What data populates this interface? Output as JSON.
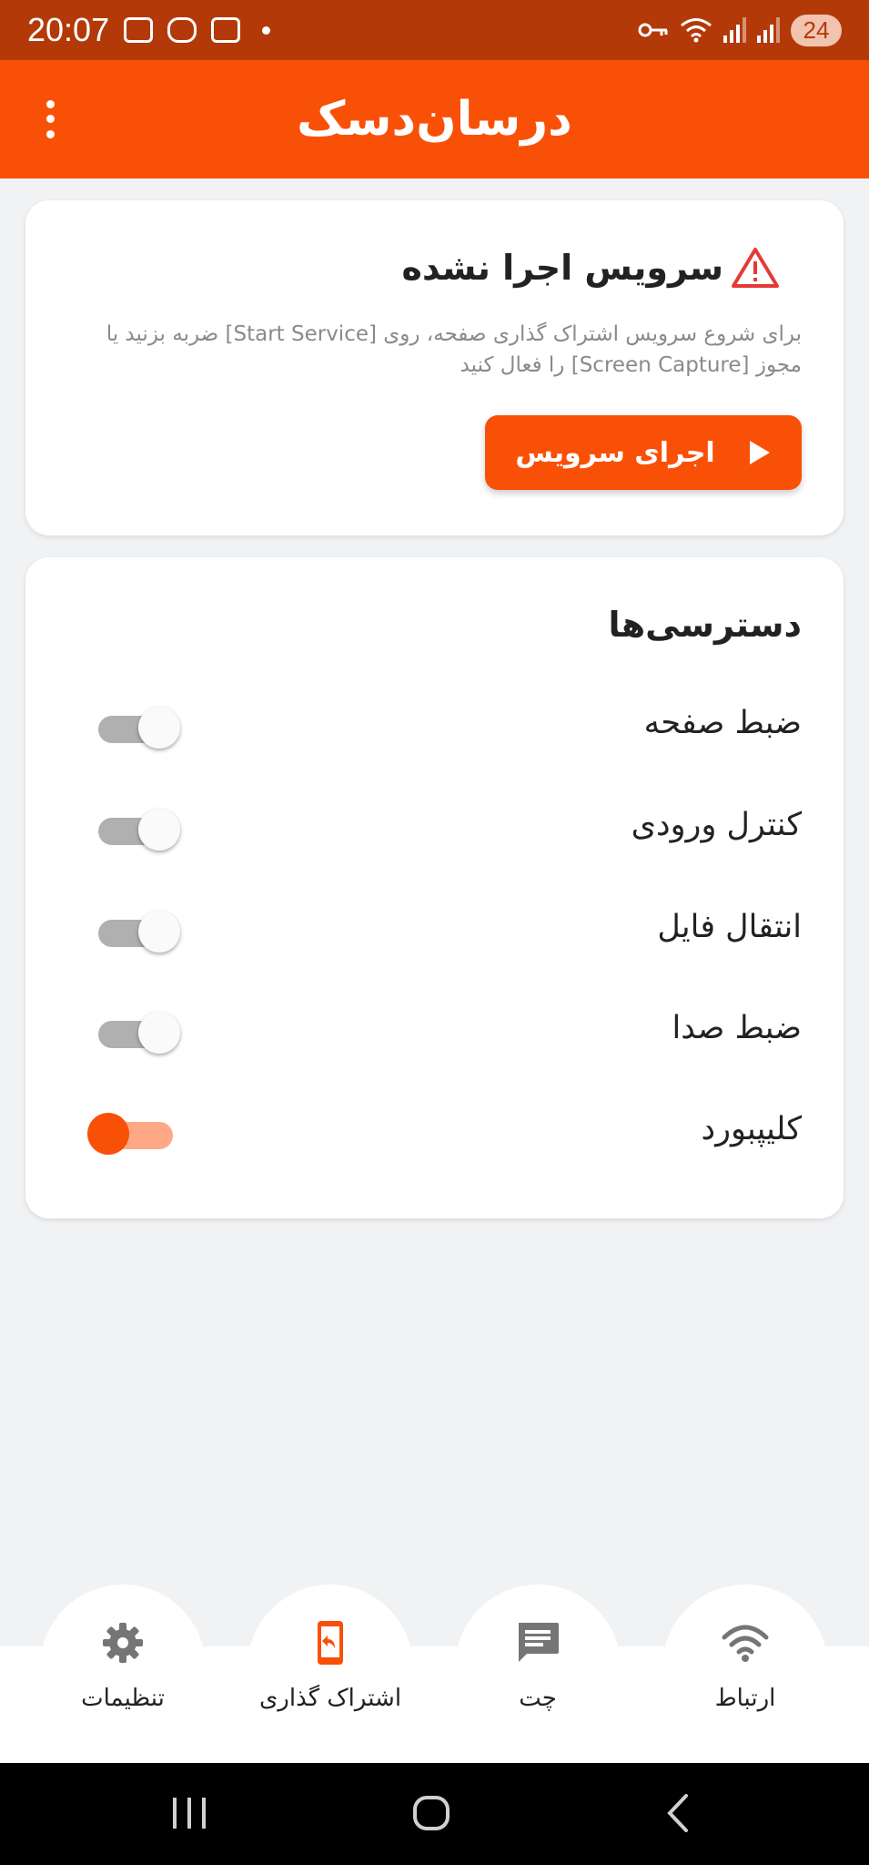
{
  "status_bar": {
    "time": "20:07",
    "battery": "24"
  },
  "app_bar": {
    "title": "درسان‌دسک",
    "menu_icon": "more-vert-icon"
  },
  "service_card": {
    "title": "سرویس اجرا نشده",
    "icon": "warning-icon",
    "description": "برای شروع سرویس اشتراک گذاری صفحه، روی [Start Service] ضربه بزنید یا مجوز [Screen Capture] را فعال کنید",
    "button_label": "اجرای سرویس",
    "button_icon": "play-icon"
  },
  "permissions": {
    "title": "دسترسی‌ها",
    "items": [
      {
        "label": "ضبط صفحه",
        "enabled": false
      },
      {
        "label": "کنترل ورودی",
        "enabled": false
      },
      {
        "label": "انتقال فایل",
        "enabled": false
      },
      {
        "label": "ضبط صدا",
        "enabled": false
      },
      {
        "label": "کلیپبورد",
        "enabled": true
      }
    ]
  },
  "bottom_nav": {
    "items": [
      {
        "label": "تنظیمات",
        "icon": "gear-icon",
        "active": false
      },
      {
        "label": "اشتراک گذاری",
        "icon": "share-screen-icon",
        "active": true
      },
      {
        "label": "چت",
        "icon": "chat-icon",
        "active": false
      },
      {
        "label": "ارتباط",
        "icon": "wifi-icon",
        "active": false
      }
    ]
  },
  "colors": {
    "accent": "#f95008",
    "status_bar": "#b33a08",
    "background": "#f1f2f4",
    "inactive_icon": "#757575"
  }
}
